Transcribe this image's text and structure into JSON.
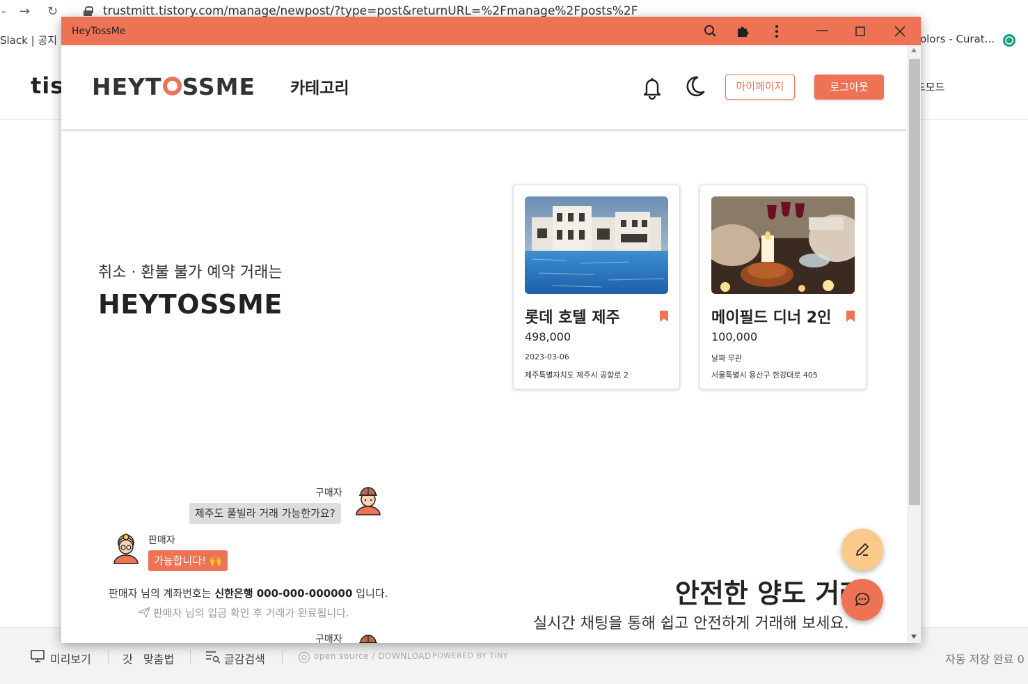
{
  "background": {
    "url": "trustmitt.tistory.com/manage/newpost/?type=post&returnURL=%2Fmanage%2Fposts%2F",
    "bookmarks": [
      "Slack | 공지",
      "olors - Curat..."
    ],
    "tistory_logo": "tist",
    "mode_label": "드모드",
    "footer": {
      "preview": "미리보기",
      "spellcheck": "맞춤법",
      "search": "글감검색",
      "opensource": "open source / DOWNLOAD",
      "powered": "POWERED BY TINY",
      "autosave": "자동 저장 완료 0"
    }
  },
  "window": {
    "title": "HeyTossMe"
  },
  "header": {
    "logo_left": "HEYT",
    "logo_right": "SSME",
    "category": "카테고리",
    "mypage": "마이페이지",
    "logout": "로그아웃"
  },
  "hero": {
    "subtitle": "취소 · 환불 불가 예약 거래는",
    "title": "HEYTOSSME"
  },
  "cards": [
    {
      "name": "롯데 호텔 제주",
      "price": "498,000",
      "date": "2023-03-06",
      "address": "제주특별자치도 제주시 공항로 2"
    },
    {
      "name": "메이필드 디너 2인",
      "price": "100,000",
      "date": "날짜 무관",
      "address": "서울특별시 용산구 한강대로 405"
    }
  ],
  "chat": {
    "buyer_name": "구매자",
    "buyer_message": "제주도 풀빌라 거래 가능한가요?",
    "seller_name": "판매자",
    "seller_message": "가능합니다! 🙌",
    "account_prefix": "판매자 님의 계좌번호는 ",
    "account_bank": "신한은행 000-000-000000",
    "account_suffix": " 입니다.",
    "confirm": "판매자 님의 입금 확인 후 거래가 완료됩니다.",
    "buyer_name_2": "구매자"
  },
  "safe": {
    "title": "안전한 양도 거래",
    "subtitle": "실시간 채팅을 통해 쉽고 안전하게 거래해 보세요."
  },
  "colors": {
    "accent": "#ee7355",
    "fab_edit": "#fbc98a"
  }
}
